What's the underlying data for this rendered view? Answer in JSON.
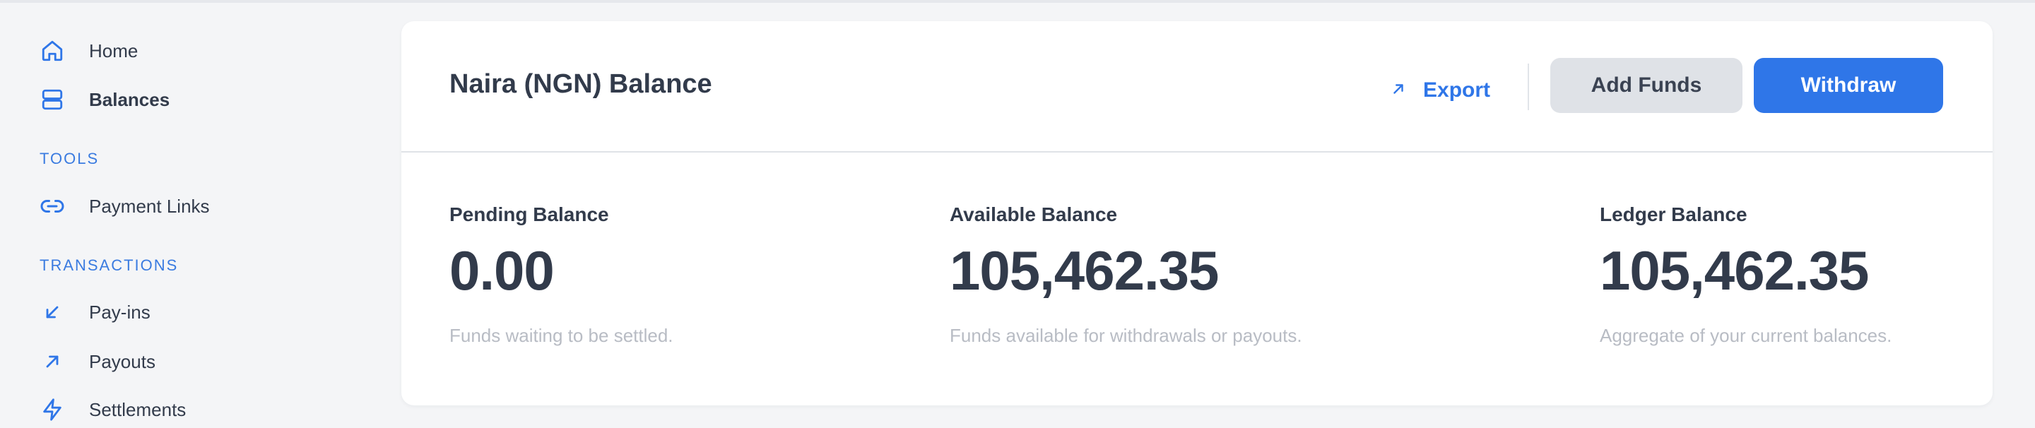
{
  "colors": {
    "accent": "#2f76e8",
    "text": "#323b4b",
    "muted": "#b8bcc4",
    "section": "#3a7be0",
    "background": "#f4f5f7"
  },
  "sidebar": {
    "items": [
      {
        "label": "Home",
        "icon": "home-icon"
      },
      {
        "label": "Balances",
        "icon": "balances-icon",
        "active": true
      }
    ],
    "sections": [
      {
        "title": "TOOLS",
        "items": [
          {
            "label": "Payment Links",
            "icon": "link-icon"
          }
        ]
      },
      {
        "title": "TRANSACTIONS",
        "items": [
          {
            "label": "Pay-ins",
            "icon": "arrow-down-left-icon"
          },
          {
            "label": "Payouts",
            "icon": "arrow-up-right-icon"
          },
          {
            "label": "Settlements",
            "icon": "lightning-icon"
          }
        ]
      }
    ]
  },
  "balance_card": {
    "title": "Naira (NGN) Balance",
    "export_label": "Export",
    "add_funds_label": "Add Funds",
    "withdraw_label": "Withdraw",
    "stats": [
      {
        "label": "Pending Balance",
        "value": "0.00",
        "description": "Funds waiting to be settled."
      },
      {
        "label": "Available Balance",
        "value": "105,462.35",
        "description": "Funds available for withdrawals or payouts."
      },
      {
        "label": "Ledger Balance",
        "value": "105,462.35",
        "description": "Aggregate of your current balances."
      }
    ]
  }
}
